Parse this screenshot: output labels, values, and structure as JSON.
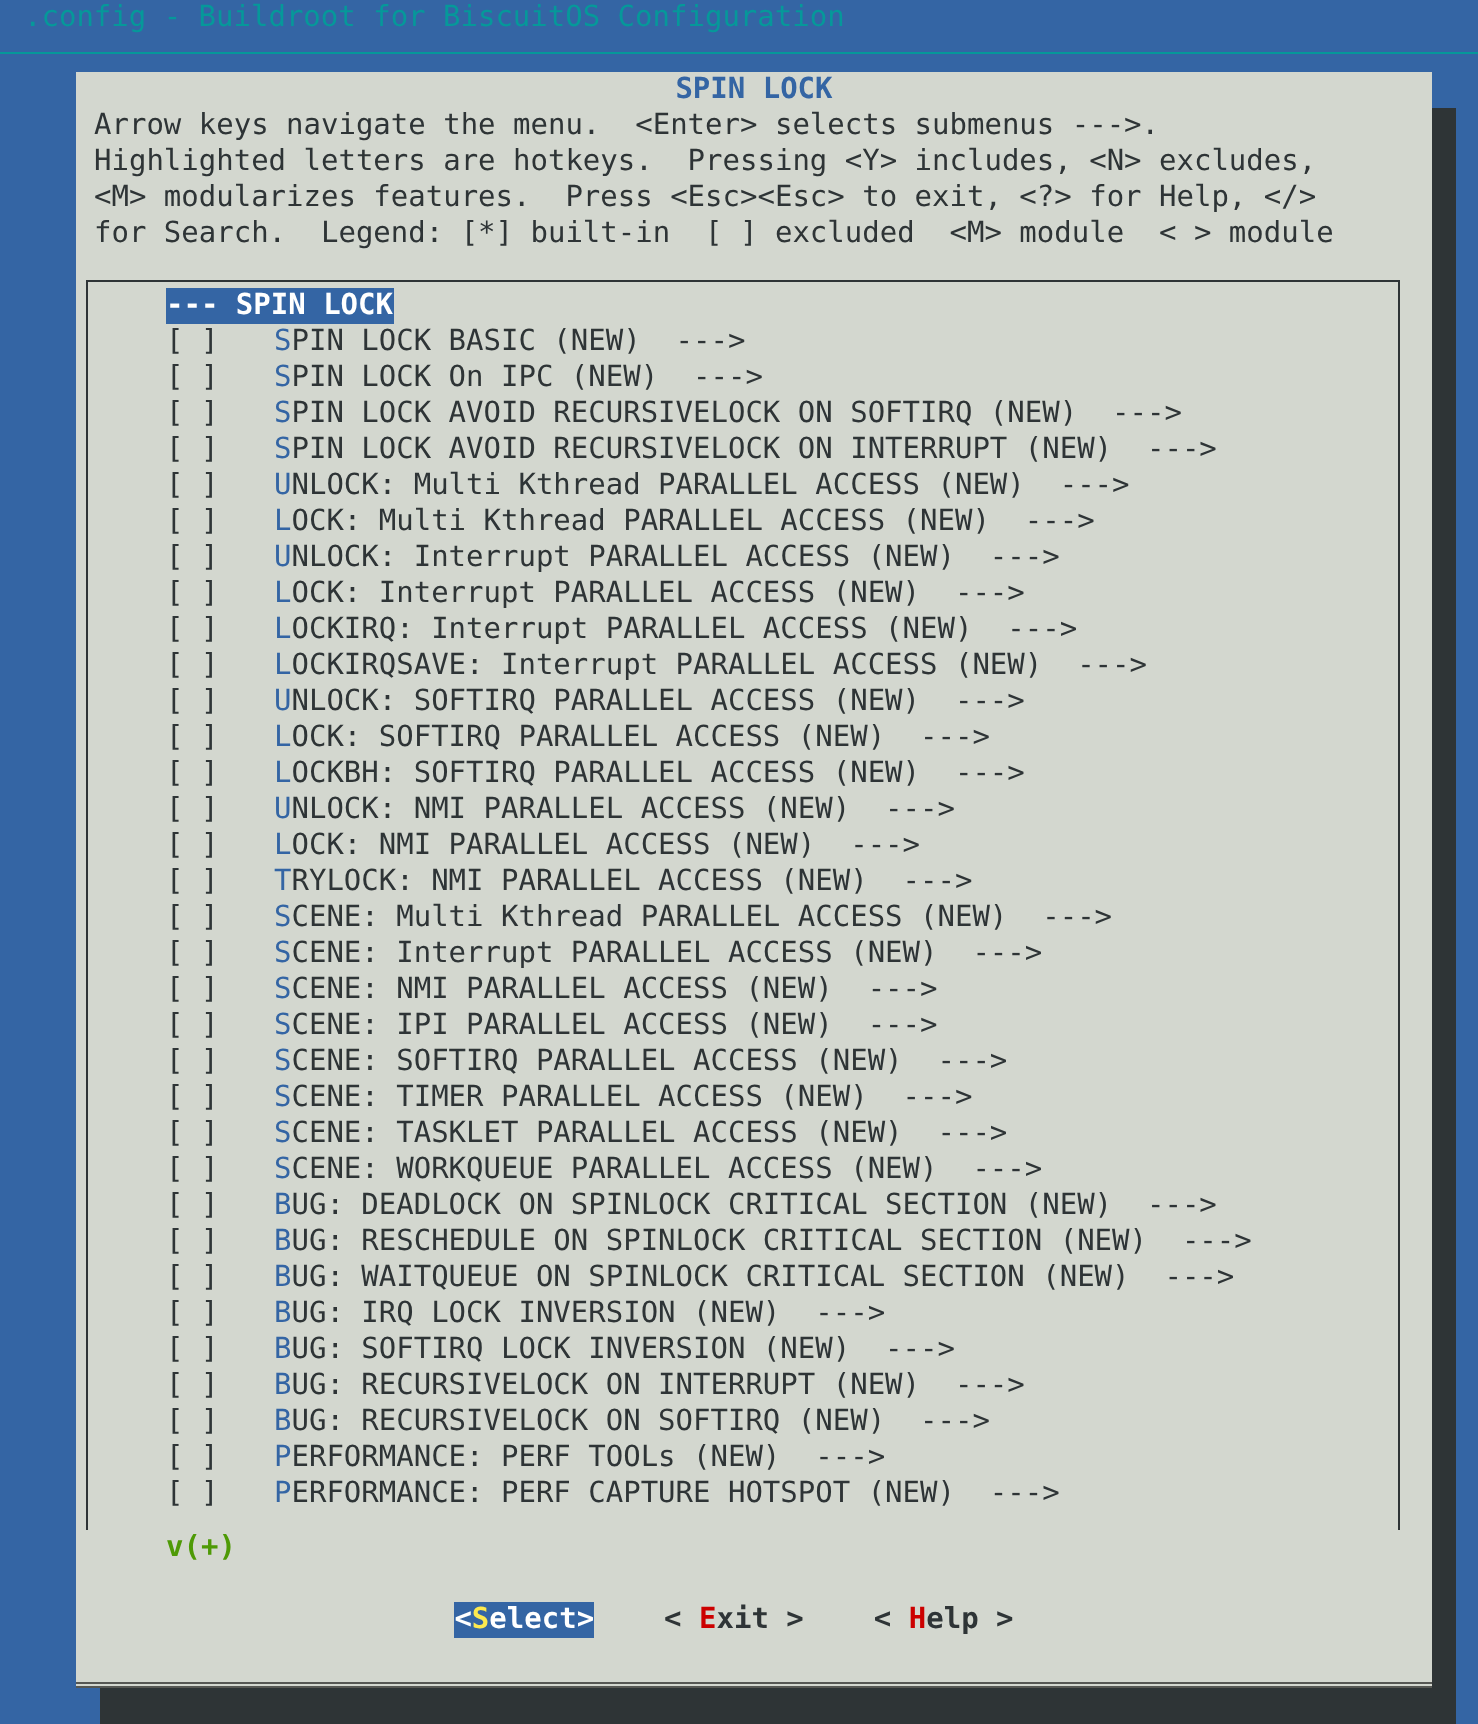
{
  "window": {
    "title": ".config - Buildroot for BiscuitOS Configuration"
  },
  "dialog": {
    "title": "SPIN LOCK",
    "help_lines": [
      "Arrow keys navigate the menu.  <Enter> selects submenus --->.",
      "Highlighted letters are hotkeys.  Pressing <Y> includes, <N> excludes,",
      "<M> modularizes features.  Press <Esc><Esc> to exit, <?> for Help, </>",
      "for Search.  Legend: [*] built-in  [ ] excluded  <M> module  < > module"
    ]
  },
  "menu": {
    "items": [
      {
        "kind": "header",
        "label": "--- SPIN LOCK",
        "selected": true
      },
      {
        "kind": "option",
        "box": "[ ]",
        "checked": false,
        "label": "SPIN LOCK BASIC (NEW)  --->",
        "selected": false
      },
      {
        "kind": "option",
        "box": "[ ]",
        "checked": false,
        "label": "SPIN LOCK On IPC (NEW)  --->",
        "selected": false
      },
      {
        "kind": "option",
        "box": "[ ]",
        "checked": false,
        "label": "SPIN LOCK AVOID RECURSIVELOCK ON SOFTIRQ (NEW)  --->",
        "selected": false
      },
      {
        "kind": "option",
        "box": "[ ]",
        "checked": false,
        "label": "SPIN LOCK AVOID RECURSIVELOCK ON INTERRUPT (NEW)  --->",
        "selected": false
      },
      {
        "kind": "option",
        "box": "[ ]",
        "checked": false,
        "label": "UNLOCK: Multi Kthread PARALLEL ACCESS (NEW)  --->",
        "selected": false
      },
      {
        "kind": "option",
        "box": "[ ]",
        "checked": false,
        "label": "LOCK: Multi Kthread PARALLEL ACCESS (NEW)  --->",
        "selected": false
      },
      {
        "kind": "option",
        "box": "[ ]",
        "checked": false,
        "label": "UNLOCK: Interrupt PARALLEL ACCESS (NEW)  --->",
        "selected": false
      },
      {
        "kind": "option",
        "box": "[ ]",
        "checked": false,
        "label": "LOCK: Interrupt PARALLEL ACCESS (NEW)  --->",
        "selected": false
      },
      {
        "kind": "option",
        "box": "[ ]",
        "checked": false,
        "label": "LOCKIRQ: Interrupt PARALLEL ACCESS (NEW)  --->",
        "selected": false
      },
      {
        "kind": "option",
        "box": "[ ]",
        "checked": false,
        "label": "LOCKIRQSAVE: Interrupt PARALLEL ACCESS (NEW)  --->",
        "selected": false
      },
      {
        "kind": "option",
        "box": "[ ]",
        "checked": false,
        "label": "UNLOCK: SOFTIRQ PARALLEL ACCESS (NEW)  --->",
        "selected": false
      },
      {
        "kind": "option",
        "box": "[ ]",
        "checked": false,
        "label": "LOCK: SOFTIRQ PARALLEL ACCESS (NEW)  --->",
        "selected": false
      },
      {
        "kind": "option",
        "box": "[ ]",
        "checked": false,
        "label": "LOCKBH: SOFTIRQ PARALLEL ACCESS (NEW)  --->",
        "selected": false
      },
      {
        "kind": "option",
        "box": "[ ]",
        "checked": false,
        "label": "UNLOCK: NMI PARALLEL ACCESS (NEW)  --->",
        "selected": false
      },
      {
        "kind": "option",
        "box": "[ ]",
        "checked": false,
        "label": "LOCK: NMI PARALLEL ACCESS (NEW)  --->",
        "selected": false
      },
      {
        "kind": "option",
        "box": "[ ]",
        "checked": false,
        "label": "TRYLOCK: NMI PARALLEL ACCESS (NEW)  --->",
        "selected": false
      },
      {
        "kind": "option",
        "box": "[ ]",
        "checked": false,
        "label": "SCENE: Multi Kthread PARALLEL ACCESS (NEW)  --->",
        "selected": false
      },
      {
        "kind": "option",
        "box": "[ ]",
        "checked": false,
        "label": "SCENE: Interrupt PARALLEL ACCESS (NEW)  --->",
        "selected": false
      },
      {
        "kind": "option",
        "box": "[ ]",
        "checked": false,
        "label": "SCENE: NMI PARALLEL ACCESS (NEW)  --->",
        "selected": false
      },
      {
        "kind": "option",
        "box": "[ ]",
        "checked": false,
        "label": "SCENE: IPI PARALLEL ACCESS (NEW)  --->",
        "selected": false
      },
      {
        "kind": "option",
        "box": "[ ]",
        "checked": false,
        "label": "SCENE: SOFTIRQ PARALLEL ACCESS (NEW)  --->",
        "selected": false
      },
      {
        "kind": "option",
        "box": "[ ]",
        "checked": false,
        "label": "SCENE: TIMER PARALLEL ACCESS (NEW)  --->",
        "selected": false
      },
      {
        "kind": "option",
        "box": "[ ]",
        "checked": false,
        "label": "SCENE: TASKLET PARALLEL ACCESS (NEW)  --->",
        "selected": false
      },
      {
        "kind": "option",
        "box": "[ ]",
        "checked": false,
        "label": "SCENE: WORKQUEUE PARALLEL ACCESS (NEW)  --->",
        "selected": false
      },
      {
        "kind": "option",
        "box": "[ ]",
        "checked": false,
        "label": "BUG: DEADLOCK ON SPINLOCK CRITICAL SECTION (NEW)  --->",
        "selected": false
      },
      {
        "kind": "option",
        "box": "[ ]",
        "checked": false,
        "label": "BUG: RESCHEDULE ON SPINLOCK CRITICAL SECTION (NEW)  --->",
        "selected": false
      },
      {
        "kind": "option",
        "box": "[ ]",
        "checked": false,
        "label": "BUG: WAITQUEUE ON SPINLOCK CRITICAL SECTION (NEW)  --->",
        "selected": false
      },
      {
        "kind": "option",
        "box": "[ ]",
        "checked": false,
        "label": "BUG: IRQ LOCK INVERSION (NEW)  --->",
        "selected": false
      },
      {
        "kind": "option",
        "box": "[ ]",
        "checked": false,
        "label": "BUG: SOFTIRQ LOCK INVERSION (NEW)  --->",
        "selected": false
      },
      {
        "kind": "option",
        "box": "[ ]",
        "checked": false,
        "label": "BUG: RECURSIVELOCK ON INTERRUPT (NEW)  --->",
        "selected": false
      },
      {
        "kind": "option",
        "box": "[ ]",
        "checked": false,
        "label": "BUG: RECURSIVELOCK ON SOFTIRQ (NEW)  --->",
        "selected": false
      },
      {
        "kind": "option",
        "box": "[ ]",
        "checked": false,
        "label": "PERFORMANCE: PERF TOOLs (NEW)  --->",
        "selected": false
      },
      {
        "kind": "option",
        "box": "[ ]",
        "checked": false,
        "label": "PERFORMANCE: PERF CAPTURE HOTSPOT (NEW)  --->",
        "selected": false
      }
    ],
    "more_indicator": "v(+)"
  },
  "buttons": [
    {
      "left": "<",
      "hotkey": "S",
      "rest": "elect",
      "right": ">",
      "selected": true
    },
    {
      "left": "< ",
      "hotkey": "E",
      "rest": "xit",
      "right": " >",
      "selected": false
    },
    {
      "left": "< ",
      "hotkey": "H",
      "rest": "elp",
      "right": " >",
      "selected": false
    }
  ]
}
